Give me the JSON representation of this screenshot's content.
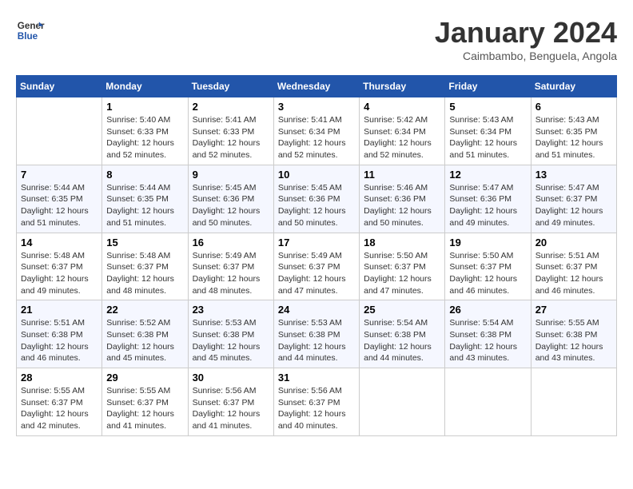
{
  "header": {
    "logo_line1": "General",
    "logo_line2": "Blue",
    "month_title": "January 2024",
    "location": "Caimbambo, Benguela, Angola"
  },
  "days_of_week": [
    "Sunday",
    "Monday",
    "Tuesday",
    "Wednesday",
    "Thursday",
    "Friday",
    "Saturday"
  ],
  "weeks": [
    [
      {
        "day": "",
        "sunrise": "",
        "sunset": "",
        "daylight": ""
      },
      {
        "day": "1",
        "sunrise": "Sunrise: 5:40 AM",
        "sunset": "Sunset: 6:33 PM",
        "daylight": "Daylight: 12 hours and 52 minutes."
      },
      {
        "day": "2",
        "sunrise": "Sunrise: 5:41 AM",
        "sunset": "Sunset: 6:33 PM",
        "daylight": "Daylight: 12 hours and 52 minutes."
      },
      {
        "day": "3",
        "sunrise": "Sunrise: 5:41 AM",
        "sunset": "Sunset: 6:34 PM",
        "daylight": "Daylight: 12 hours and 52 minutes."
      },
      {
        "day": "4",
        "sunrise": "Sunrise: 5:42 AM",
        "sunset": "Sunset: 6:34 PM",
        "daylight": "Daylight: 12 hours and 52 minutes."
      },
      {
        "day": "5",
        "sunrise": "Sunrise: 5:43 AM",
        "sunset": "Sunset: 6:34 PM",
        "daylight": "Daylight: 12 hours and 51 minutes."
      },
      {
        "day": "6",
        "sunrise": "Sunrise: 5:43 AM",
        "sunset": "Sunset: 6:35 PM",
        "daylight": "Daylight: 12 hours and 51 minutes."
      }
    ],
    [
      {
        "day": "7",
        "sunrise": "Sunrise: 5:44 AM",
        "sunset": "Sunset: 6:35 PM",
        "daylight": "Daylight: 12 hours and 51 minutes."
      },
      {
        "day": "8",
        "sunrise": "Sunrise: 5:44 AM",
        "sunset": "Sunset: 6:35 PM",
        "daylight": "Daylight: 12 hours and 51 minutes."
      },
      {
        "day": "9",
        "sunrise": "Sunrise: 5:45 AM",
        "sunset": "Sunset: 6:36 PM",
        "daylight": "Daylight: 12 hours and 50 minutes."
      },
      {
        "day": "10",
        "sunrise": "Sunrise: 5:45 AM",
        "sunset": "Sunset: 6:36 PM",
        "daylight": "Daylight: 12 hours and 50 minutes."
      },
      {
        "day": "11",
        "sunrise": "Sunrise: 5:46 AM",
        "sunset": "Sunset: 6:36 PM",
        "daylight": "Daylight: 12 hours and 50 minutes."
      },
      {
        "day": "12",
        "sunrise": "Sunrise: 5:47 AM",
        "sunset": "Sunset: 6:36 PM",
        "daylight": "Daylight: 12 hours and 49 minutes."
      },
      {
        "day": "13",
        "sunrise": "Sunrise: 5:47 AM",
        "sunset": "Sunset: 6:37 PM",
        "daylight": "Daylight: 12 hours and 49 minutes."
      }
    ],
    [
      {
        "day": "14",
        "sunrise": "Sunrise: 5:48 AM",
        "sunset": "Sunset: 6:37 PM",
        "daylight": "Daylight: 12 hours and 49 minutes."
      },
      {
        "day": "15",
        "sunrise": "Sunrise: 5:48 AM",
        "sunset": "Sunset: 6:37 PM",
        "daylight": "Daylight: 12 hours and 48 minutes."
      },
      {
        "day": "16",
        "sunrise": "Sunrise: 5:49 AM",
        "sunset": "Sunset: 6:37 PM",
        "daylight": "Daylight: 12 hours and 48 minutes."
      },
      {
        "day": "17",
        "sunrise": "Sunrise: 5:49 AM",
        "sunset": "Sunset: 6:37 PM",
        "daylight": "Daylight: 12 hours and 47 minutes."
      },
      {
        "day": "18",
        "sunrise": "Sunrise: 5:50 AM",
        "sunset": "Sunset: 6:37 PM",
        "daylight": "Daylight: 12 hours and 47 minutes."
      },
      {
        "day": "19",
        "sunrise": "Sunrise: 5:50 AM",
        "sunset": "Sunset: 6:37 PM",
        "daylight": "Daylight: 12 hours and 46 minutes."
      },
      {
        "day": "20",
        "sunrise": "Sunrise: 5:51 AM",
        "sunset": "Sunset: 6:37 PM",
        "daylight": "Daylight: 12 hours and 46 minutes."
      }
    ],
    [
      {
        "day": "21",
        "sunrise": "Sunrise: 5:51 AM",
        "sunset": "Sunset: 6:38 PM",
        "daylight": "Daylight: 12 hours and 46 minutes."
      },
      {
        "day": "22",
        "sunrise": "Sunrise: 5:52 AM",
        "sunset": "Sunset: 6:38 PM",
        "daylight": "Daylight: 12 hours and 45 minutes."
      },
      {
        "day": "23",
        "sunrise": "Sunrise: 5:53 AM",
        "sunset": "Sunset: 6:38 PM",
        "daylight": "Daylight: 12 hours and 45 minutes."
      },
      {
        "day": "24",
        "sunrise": "Sunrise: 5:53 AM",
        "sunset": "Sunset: 6:38 PM",
        "daylight": "Daylight: 12 hours and 44 minutes."
      },
      {
        "day": "25",
        "sunrise": "Sunrise: 5:54 AM",
        "sunset": "Sunset: 6:38 PM",
        "daylight": "Daylight: 12 hours and 44 minutes."
      },
      {
        "day": "26",
        "sunrise": "Sunrise: 5:54 AM",
        "sunset": "Sunset: 6:38 PM",
        "daylight": "Daylight: 12 hours and 43 minutes."
      },
      {
        "day": "27",
        "sunrise": "Sunrise: 5:55 AM",
        "sunset": "Sunset: 6:38 PM",
        "daylight": "Daylight: 12 hours and 43 minutes."
      }
    ],
    [
      {
        "day": "28",
        "sunrise": "Sunrise: 5:55 AM",
        "sunset": "Sunset: 6:37 PM",
        "daylight": "Daylight: 12 hours and 42 minutes."
      },
      {
        "day": "29",
        "sunrise": "Sunrise: 5:55 AM",
        "sunset": "Sunset: 6:37 PM",
        "daylight": "Daylight: 12 hours and 41 minutes."
      },
      {
        "day": "30",
        "sunrise": "Sunrise: 5:56 AM",
        "sunset": "Sunset: 6:37 PM",
        "daylight": "Daylight: 12 hours and 41 minutes."
      },
      {
        "day": "31",
        "sunrise": "Sunrise: 5:56 AM",
        "sunset": "Sunset: 6:37 PM",
        "daylight": "Daylight: 12 hours and 40 minutes."
      },
      {
        "day": "",
        "sunrise": "",
        "sunset": "",
        "daylight": ""
      },
      {
        "day": "",
        "sunrise": "",
        "sunset": "",
        "daylight": ""
      },
      {
        "day": "",
        "sunrise": "",
        "sunset": "",
        "daylight": ""
      }
    ]
  ]
}
